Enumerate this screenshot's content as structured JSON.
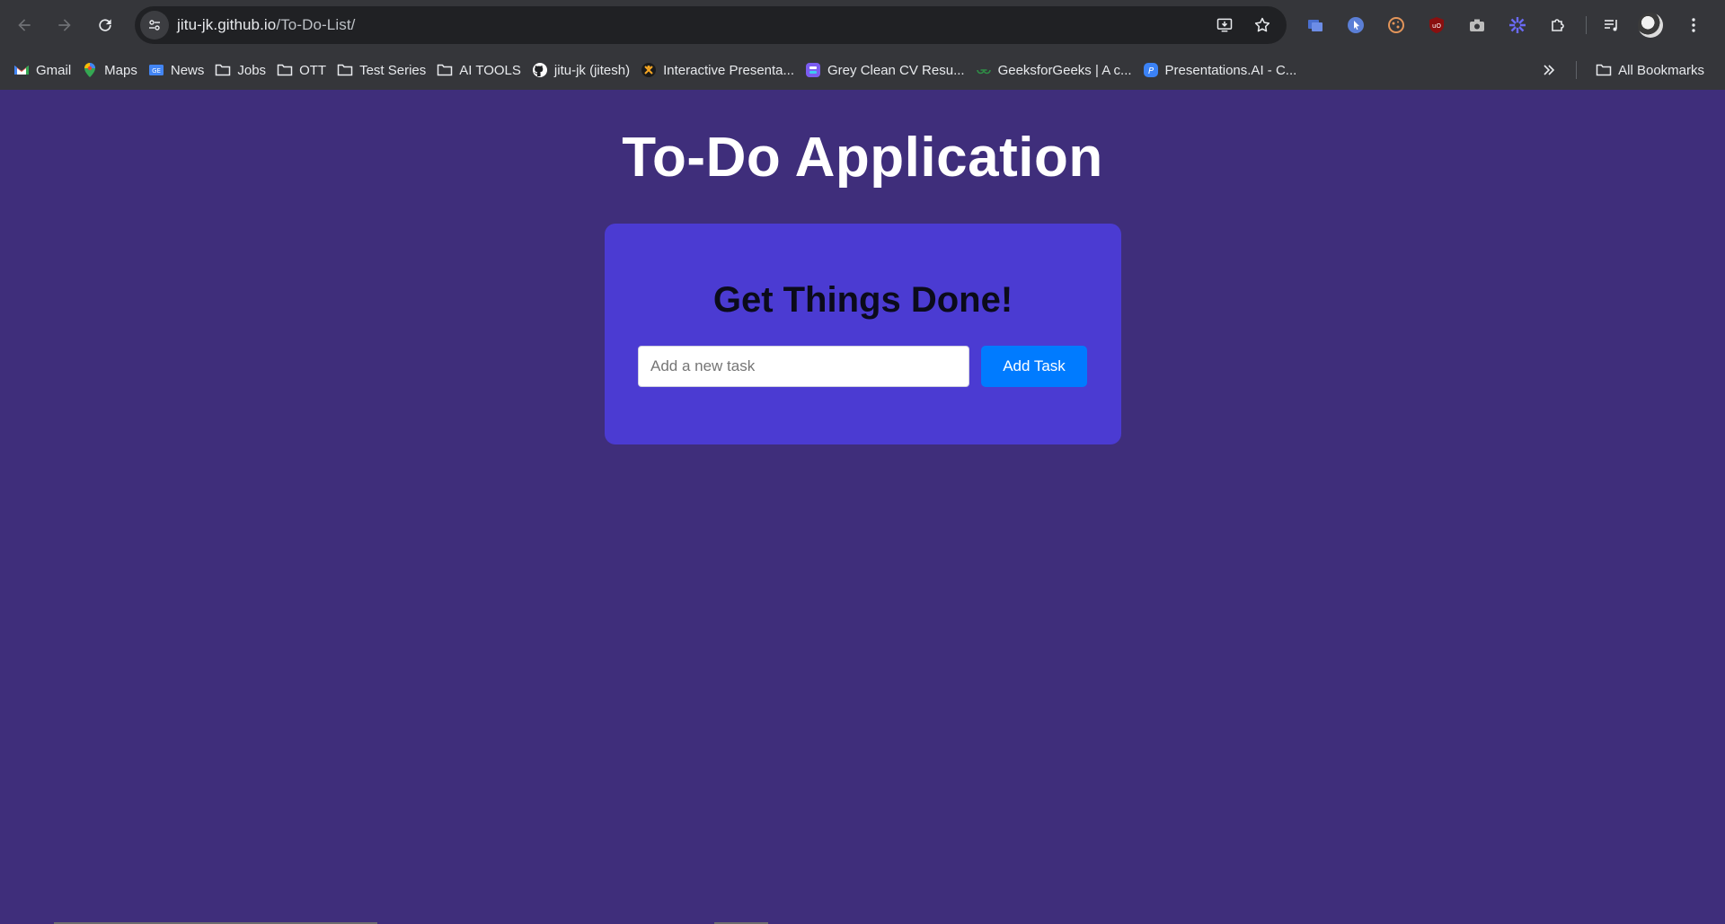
{
  "browser": {
    "url_host": "jitu-jk.github.io",
    "url_path": "/To-Do-List/",
    "bookmarks": [
      {
        "label": "Gmail",
        "icon": "gmail-icon"
      },
      {
        "label": "Maps",
        "icon": "maps-icon"
      },
      {
        "label": "News",
        "icon": "news-icon"
      },
      {
        "label": "Jobs",
        "icon": "folder-icon"
      },
      {
        "label": "OTT",
        "icon": "folder-icon"
      },
      {
        "label": "Test Series",
        "icon": "folder-icon"
      },
      {
        "label": "AI TOOLS",
        "icon": "folder-icon"
      },
      {
        "label": "jitu-jk (jitesh)",
        "icon": "github-icon"
      },
      {
        "label": "Interactive Presenta...",
        "icon": "presentation-icon"
      },
      {
        "label": "Grey Clean CV Resu...",
        "icon": "canva-icon"
      },
      {
        "label": "GeeksforGeeks | A c...",
        "icon": "geeksforgeeks-icon"
      },
      {
        "label": "Presentations.AI - C...",
        "icon": "presentations-ai-icon"
      }
    ],
    "all_bookmarks_label": "All Bookmarks"
  },
  "app": {
    "title": "To-Do Application",
    "card_title": "Get Things Done!",
    "input_placeholder": "Add a new task",
    "input_value": "",
    "add_button_label": "Add Task"
  },
  "colors": {
    "page_background": "#3f2e7b",
    "card_background": "#4b3bd2",
    "button_background": "#007bff"
  }
}
